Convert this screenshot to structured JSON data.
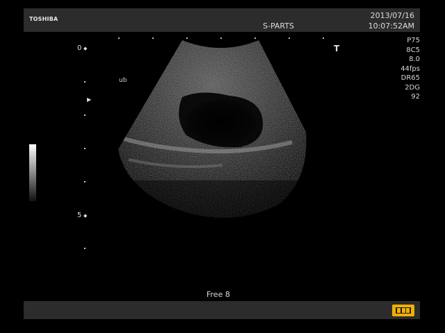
{
  "header": {
    "brand": "TOSHIBA",
    "preset": "S-PARTS",
    "date": "2013/07/16",
    "time": "10:07:52AM"
  },
  "params": {
    "probe": "P75",
    "transducer": "8C5",
    "frequency": "8.0",
    "frame_rate": "44fps",
    "dynamic_range": "DR65",
    "gain_mode": "2DG",
    "gain_value": "92"
  },
  "depth_scale": {
    "label_top": "0",
    "label_mid": "5"
  },
  "annotations": {
    "body_label": "ub",
    "mode_label": "Free 8",
    "orientation_mark": "T"
  },
  "icons": {
    "cine_loop": "cine-loop-icon",
    "focus": "focus-arrow-icon"
  },
  "colors": {
    "background": "#000000",
    "band": "#2c2c2c",
    "text": "#dcdcdc",
    "cine_icon": "#f0b000"
  }
}
